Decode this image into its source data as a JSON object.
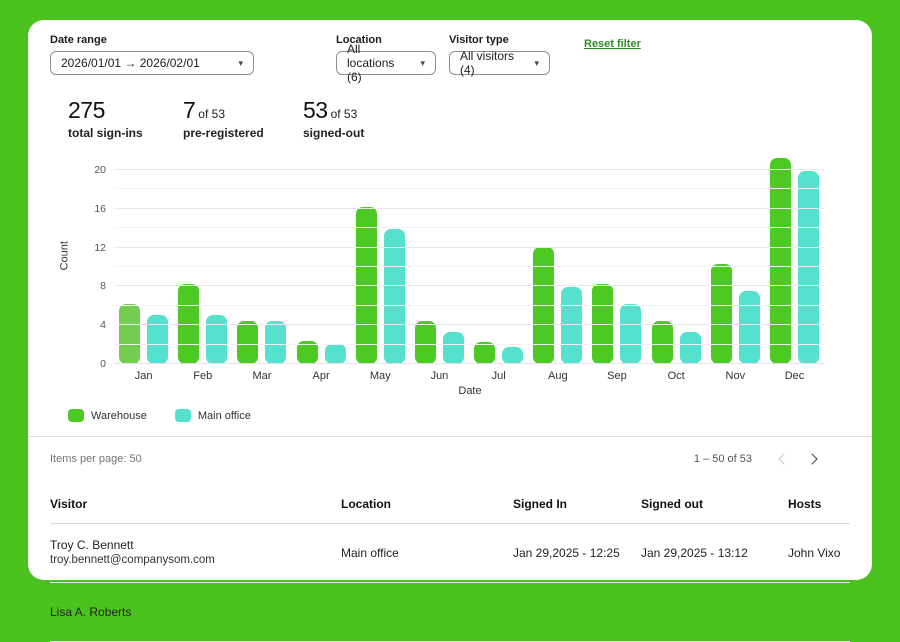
{
  "filters": {
    "date_range": {
      "label": "Date range",
      "value": "2026/01/01 → 2026/02/01"
    },
    "location": {
      "label": "Location",
      "value": "All locations (6)"
    },
    "visitor_type": {
      "label": "Visitor type",
      "value": "All visitors (4)"
    },
    "reset_label": "Reset filter"
  },
  "stats": [
    {
      "value": "275",
      "suffix": "",
      "label": "total sign-ins"
    },
    {
      "value": "7",
      "suffix": "of 53",
      "label": "pre-registered"
    },
    {
      "value": "53",
      "suffix": "of 53",
      "label": "signed-out"
    }
  ],
  "chart_data": {
    "type": "bar",
    "title": "",
    "xlabel": "Date",
    "ylabel": "Count",
    "ylim": [
      0,
      20
    ],
    "yticks": [
      0,
      4,
      8,
      12,
      16,
      20
    ],
    "grid": "horizontal, minor lines every 2",
    "legend_position": "bottom-left",
    "categories": [
      "Jan",
      "Feb",
      "Mar",
      "Apr",
      "May",
      "Jun",
      "Jul",
      "Aug",
      "Sep",
      "Oct",
      "Nov",
      "Dec"
    ],
    "series": [
      {
        "name": "Warehouse",
        "color": "#4cc922",
        "values": [
          6.2,
          8.2,
          4.4,
          2.4,
          16.2,
          4.4,
          2.3,
          12.1,
          8.2,
          4.4,
          10.3,
          21.2
        ]
      },
      {
        "name": "Main office",
        "color": "#56e0ce",
        "values": [
          5.1,
          5.1,
          4.4,
          2.1,
          13.9,
          3.3,
          1.8,
          7.9,
          6.2,
          3.3,
          7.5,
          19.9
        ]
      }
    ],
    "highlight": {
      "series": 0,
      "index": 0,
      "color": "#73cd4f"
    }
  },
  "legend": [
    {
      "label": "Warehouse",
      "color": "#4cc922"
    },
    {
      "label": "Main office",
      "color": "#56e0ce"
    }
  ],
  "paginator": {
    "items_per_page": "Items per page: 50",
    "range": "1 – 50 of 53"
  },
  "table": {
    "columns": [
      "Visitor",
      "Location",
      "Signed In",
      "Signed out",
      "Hosts"
    ],
    "rows": [
      {
        "name": "Troy C. Bennett",
        "email": "troy.bennett@companysom.com",
        "location": "Main office",
        "signed_in": "Jan 29,2025 - 12:25",
        "signed_out": "Jan 29,2025 - 13:12",
        "hosts": "John Vixo"
      },
      {
        "name": "Lisa A. Roberts",
        "email": "",
        "location": "",
        "signed_in": "",
        "signed_out": "",
        "hosts": ""
      }
    ]
  },
  "colors": {
    "page_background": "#4bc31e",
    "card_background": "#ffffff",
    "link_green": "#2e8b27"
  }
}
